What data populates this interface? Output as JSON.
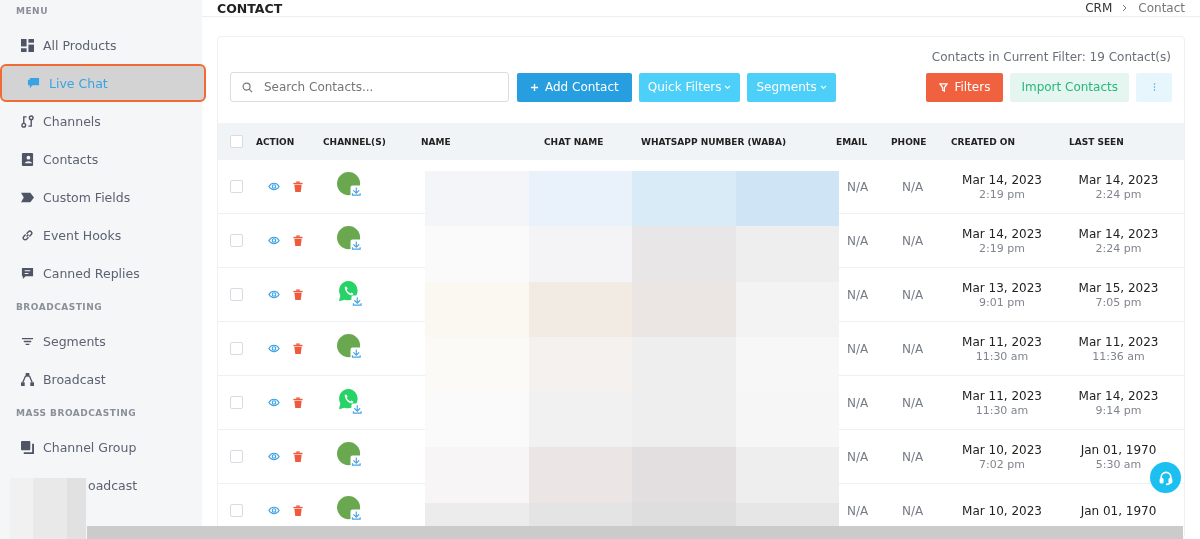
{
  "sidebar": {
    "sections": [
      {
        "title": "MENU",
        "items": [
          {
            "label": "All Products",
            "selected": false
          },
          {
            "label": "Live Chat",
            "selected": true
          },
          {
            "label": "Channels",
            "selected": false
          },
          {
            "label": "Contacts",
            "selected": false
          },
          {
            "label": "Custom Fields",
            "selected": false
          },
          {
            "label": "Event Hooks",
            "selected": false
          },
          {
            "label": "Canned Replies",
            "selected": false
          }
        ]
      },
      {
        "title": "BROADCASTING",
        "items": [
          {
            "label": "Segments",
            "selected": false
          },
          {
            "label": "Broadcast",
            "selected": false
          }
        ]
      },
      {
        "title": "MASS BROADCASTING",
        "items": [
          {
            "label": "Channel Group",
            "selected": false
          },
          {
            "label": "oadcast",
            "selected": false
          }
        ]
      }
    ]
  },
  "page": {
    "title": "CONTACT",
    "breadcrumb": [
      "CRM",
      "Contact"
    ]
  },
  "toolbar": {
    "count_text": "Contacts in Current Filter: 19 Contact(s)",
    "search": {
      "placeholder": "Search Contacts..."
    },
    "buttons": [
      {
        "label": "Add Contact",
        "kind": "add"
      },
      {
        "label": "Quick Filters",
        "kind": "dropdown"
      },
      {
        "label": "Segments",
        "kind": "dropdown"
      }
    ],
    "right_buttons": [
      {
        "label": "Filters",
        "kind": "filter"
      },
      {
        "label": "Import Contacts",
        "kind": "import"
      }
    ]
  },
  "table": {
    "select_all_checked": false,
    "columns": [
      "ACTION",
      "CHANNEL(S)",
      "NAME",
      "CHAT NAME",
      "WHATSAPP NUMBER (WABA)",
      "EMAIL",
      "PHONE",
      "CREATED ON",
      "LAST SEEN"
    ],
    "rows": [
      {
        "checked": false,
        "kind": "avatar",
        "email": "N/A",
        "phone": "N/A",
        "created_date": "Mar 14, 2023",
        "created_time": "2:19 pm",
        "seen_date": "Mar 14, 2023",
        "seen_time": "2:24 pm"
      },
      {
        "checked": false,
        "kind": "avatar",
        "email": "N/A",
        "phone": "N/A",
        "created_date": "Mar 14, 2023",
        "created_time": "2:19 pm",
        "seen_date": "Mar 14, 2023",
        "seen_time": "2:24 pm"
      },
      {
        "checked": false,
        "kind": "whatsapp",
        "email": "N/A",
        "phone": "N/A",
        "created_date": "Mar 13, 2023",
        "created_time": "9:01 pm",
        "seen_date": "Mar 15, 2023",
        "seen_time": "7:05 pm"
      },
      {
        "checked": false,
        "kind": "avatar",
        "email": "N/A",
        "phone": "N/A",
        "created_date": "Mar 11, 2023",
        "created_time": "11:30 am",
        "seen_date": "Mar 11, 2023",
        "seen_time": "11:36 am"
      },
      {
        "checked": false,
        "kind": "whatsapp",
        "email": "N/A",
        "phone": "N/A",
        "created_date": "Mar 11, 2023",
        "created_time": "11:30 am",
        "seen_date": "Mar 14, 2023",
        "seen_time": "9:14 pm"
      },
      {
        "checked": false,
        "kind": "avatar",
        "email": "N/A",
        "phone": "N/A",
        "created_date": "Mar 10, 2023",
        "created_time": "7:02 pm",
        "seen_date": "Jan 01, 1970",
        "seen_time": "5:30 am"
      },
      {
        "checked": false,
        "kind": "avatar",
        "email": "N/A",
        "phone": "N/A",
        "created_date": "Mar 10, 2023",
        "seen_date": "Jan 01, 1970"
      }
    ]
  }
}
